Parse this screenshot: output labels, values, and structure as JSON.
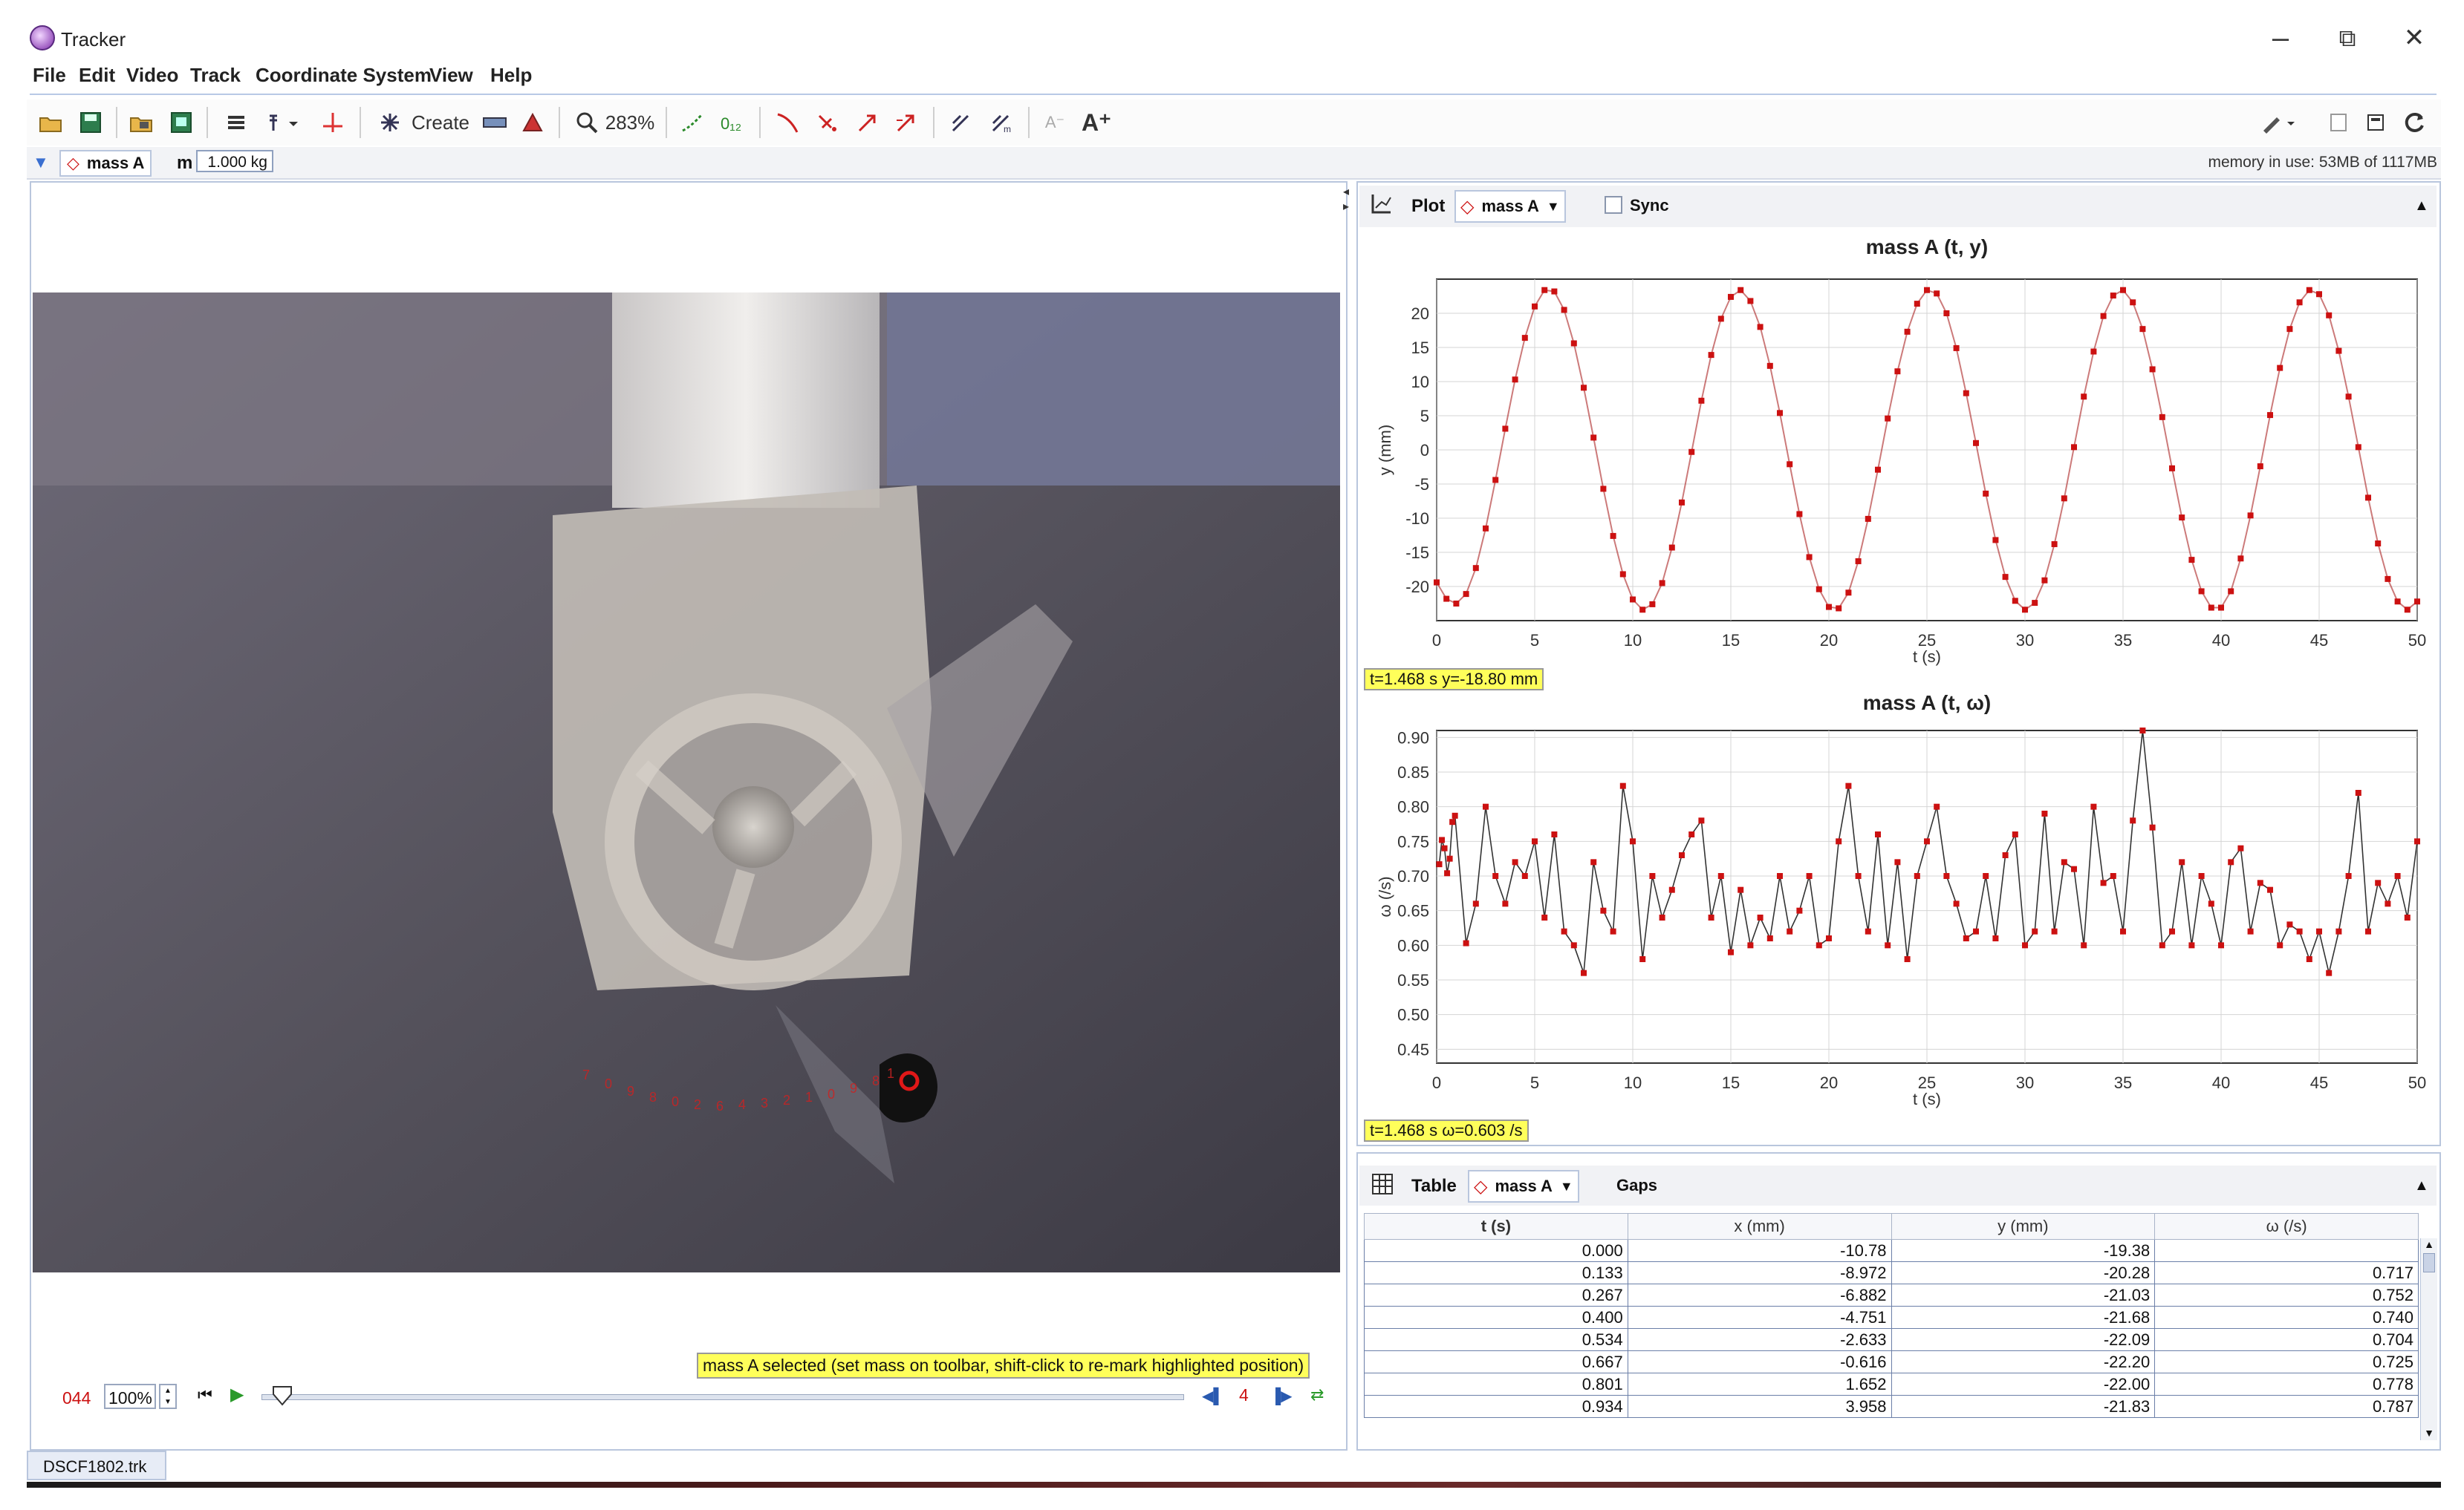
{
  "window": {
    "title": "Tracker",
    "controls": [
      "–",
      "⧉",
      "✕"
    ]
  },
  "menu": [
    "File",
    "Edit",
    "Video",
    "Track",
    "Coordinate System",
    "View",
    "Help"
  ],
  "toolbar": {
    "create_label": "Create",
    "zoom_label": "283%"
  },
  "trackbar": {
    "track_name": "mass A",
    "mass_label": "m",
    "mass_value": "1.000 kg",
    "memory": "memory in use: 53MB of 1117MB"
  },
  "video": {
    "status_message": "mass A selected (set mass on toolbar, shift-click to re-mark highlighted position)",
    "frame_number": "044",
    "rate": "100%",
    "step_size": "4"
  },
  "plot": {
    "header_label": "Plot",
    "track": "mass A",
    "sync_label": "Sync",
    "charts": [
      {
        "title": "mass A (t, y)",
        "xlabel": "t (s)",
        "ylabel": "y (mm)",
        "readout": "t=1.468 s  y=-18.80 mm"
      },
      {
        "title": "mass A (t, ω)",
        "xlabel": "t (s)",
        "ylabel": "ω (/s)",
        "readout": "t=1.468 s  ω=0.603 /s"
      }
    ]
  },
  "chart_data": [
    {
      "type": "scatter",
      "title": "mass A (t, y)",
      "xlabel": "t (s)",
      "ylabel": "y (mm)",
      "xlim": [
        0,
        50
      ],
      "ylim": [
        -25,
        25
      ],
      "xticks": [
        0,
        5,
        10,
        15,
        20,
        25,
        30,
        35,
        40,
        45,
        50
      ],
      "yticks": [
        -20,
        -15,
        -10,
        -5,
        0,
        5,
        10,
        15,
        20
      ],
      "grid": true,
      "series": [
        {
          "x": [
            0.0,
            0.5,
            1.0,
            1.5,
            2.0,
            2.5,
            3.0,
            3.5,
            4.0,
            4.5,
            5.0,
            5.5,
            6.0,
            6.5,
            7.0,
            7.5,
            8.0,
            8.5,
            9.0,
            9.5,
            10.0,
            10.5,
            11.0,
            11.5,
            12.0,
            12.5,
            13.0,
            13.5,
            14.0,
            14.5,
            15.0,
            15.5,
            16.0,
            16.5,
            17.0,
            17.5,
            18.0,
            18.5,
            19.0,
            19.5,
            20.0,
            20.5,
            21.0,
            21.5,
            22.0,
            22.5,
            23.0,
            23.5,
            24.0,
            24.5,
            25.0,
            25.5,
            26.0,
            26.5,
            27.0,
            27.5,
            28.0,
            28.5,
            29.0,
            29.5,
            30.0,
            30.5,
            31.0,
            31.5,
            32.0,
            32.5,
            33.0,
            33.5,
            34.0,
            34.5,
            35.0,
            35.5,
            36.0,
            36.5,
            37.0,
            37.5,
            38.0,
            38.5,
            39.0,
            39.5,
            40.0,
            40.5,
            41.0,
            41.5,
            42.0,
            42.5,
            43.0,
            43.5,
            44.0,
            44.5,
            45.0,
            45.5,
            46.0,
            46.5,
            47.0,
            47.5,
            48.0,
            48.5,
            49.0,
            49.5,
            50.0
          ],
          "y": [
            -19.4,
            -21.8,
            -22.5,
            -21.1,
            -17.3,
            -11.5,
            -4.4,
            3.1,
            10.3,
            16.4,
            21.0,
            23.4,
            23.2,
            20.5,
            15.6,
            9.1,
            1.8,
            -5.7,
            -12.6,
            -18.2,
            -21.9,
            -23.4,
            -22.6,
            -19.5,
            -14.3,
            -7.7,
            -0.3,
            7.2,
            13.9,
            19.2,
            22.4,
            23.4,
            21.8,
            18.0,
            12.3,
            5.4,
            -2.1,
            -9.4,
            -15.7,
            -20.4,
            -23.0,
            -23.2,
            -20.9,
            -16.3,
            -10.1,
            -2.9,
            4.6,
            11.5,
            17.3,
            21.4,
            23.4,
            22.9,
            20.0,
            14.9,
            8.3,
            1.0,
            -6.4,
            -13.2,
            -18.6,
            -22.1,
            -23.4,
            -22.4,
            -19.1,
            -13.8,
            -7.1,
            0.4,
            7.8,
            14.4,
            19.6,
            22.6,
            23.4,
            21.6,
            17.7,
            11.8,
            4.8,
            -2.7,
            -9.9,
            -16.1,
            -20.7,
            -23.1,
            -23.1,
            -20.7,
            -15.9,
            -9.6,
            -2.4,
            5.1,
            12.0,
            17.7,
            21.6,
            23.4,
            22.8,
            19.7,
            14.5,
            7.8,
            0.4,
            -7.0,
            -13.7,
            -18.9,
            -22.2,
            -23.4,
            -22.2
          ]
        }
      ]
    },
    {
      "type": "line",
      "title": "mass A (t, ω)",
      "xlabel": "t (s)",
      "ylabel": "ω (/s)",
      "xlim": [
        0,
        50
      ],
      "ylim": [
        0.43,
        0.91
      ],
      "xticks": [
        0,
        5,
        10,
        15,
        20,
        25,
        30,
        35,
        40,
        45,
        50
      ],
      "yticks": [
        0.45,
        0.5,
        0.55,
        0.6,
        0.65,
        0.7,
        0.75,
        0.8,
        0.85,
        0.9
      ],
      "grid": true,
      "series": [
        {
          "x": [
            0.133,
            0.267,
            0.4,
            0.534,
            0.667,
            0.801,
            0.934,
            1.5,
            2.0,
            2.5,
            3.0,
            3.5,
            4.0,
            4.5,
            5.0,
            5.5,
            6.0,
            6.5,
            7.0,
            7.5,
            8.0,
            8.5,
            9.0,
            9.5,
            10.0,
            10.5,
            11.0,
            11.5,
            12.0,
            12.5,
            13.0,
            13.5,
            14.0,
            14.5,
            15.0,
            15.5,
            16.0,
            16.5,
            17.0,
            17.5,
            18.0,
            18.5,
            19.0,
            19.5,
            20.0,
            20.5,
            21.0,
            21.5,
            22.0,
            22.5,
            23.0,
            23.5,
            24.0,
            24.5,
            25.0,
            25.5,
            26.0,
            26.5,
            27.0,
            27.5,
            28.0,
            28.5,
            29.0,
            29.5,
            30.0,
            30.5,
            31.0,
            31.5,
            32.0,
            32.5,
            33.0,
            33.5,
            34.0,
            34.5,
            35.0,
            35.5,
            36.0,
            36.5,
            37.0,
            37.5,
            38.0,
            38.5,
            39.0,
            39.5,
            40.0,
            40.5,
            41.0,
            41.5,
            42.0,
            42.5,
            43.0,
            43.5,
            44.0,
            44.5,
            45.0,
            45.5,
            46.0,
            46.5,
            47.0,
            47.5,
            48.0,
            48.5,
            49.0,
            49.5,
            50.0
          ],
          "y": [
            0.717,
            0.752,
            0.74,
            0.704,
            0.725,
            0.778,
            0.787,
            0.603,
            0.66,
            0.8,
            0.7,
            0.66,
            0.72,
            0.7,
            0.75,
            0.64,
            0.76,
            0.62,
            0.6,
            0.56,
            0.72,
            0.65,
            0.62,
            0.83,
            0.75,
            0.58,
            0.7,
            0.64,
            0.68,
            0.73,
            0.76,
            0.78,
            0.64,
            0.7,
            0.59,
            0.68,
            0.6,
            0.64,
            0.61,
            0.7,
            0.62,
            0.65,
            0.7,
            0.6,
            0.61,
            0.75,
            0.83,
            0.7,
            0.62,
            0.76,
            0.6,
            0.72,
            0.58,
            0.7,
            0.75,
            0.8,
            0.7,
            0.66,
            0.61,
            0.62,
            0.7,
            0.61,
            0.73,
            0.76,
            0.6,
            0.62,
            0.79,
            0.62,
            0.72,
            0.71,
            0.6,
            0.8,
            0.69,
            0.7,
            0.62,
            0.78,
            0.91,
            0.77,
            0.6,
            0.62,
            0.72,
            0.6,
            0.7,
            0.66,
            0.6,
            0.72,
            0.74,
            0.62,
            0.69,
            0.68,
            0.6,
            0.63,
            0.62,
            0.58,
            0.62,
            0.56,
            0.62,
            0.7,
            0.82,
            0.62,
            0.69,
            0.66,
            0.7,
            0.64,
            0.75
          ]
        }
      ]
    },
    {
      "type": "table",
      "columns": [
        "t (s)",
        "x (mm)",
        "y (mm)",
        "ω (/s)"
      ],
      "rows": [
        [
          "0.000",
          "-10.78",
          "-19.38",
          ""
        ],
        [
          "0.133",
          "-8.972",
          "-20.28",
          "0.717"
        ],
        [
          "0.267",
          "-6.882",
          "-21.03",
          "0.752"
        ],
        [
          "0.400",
          "-4.751",
          "-21.68",
          "0.740"
        ],
        [
          "0.534",
          "-2.633",
          "-22.09",
          "0.704"
        ],
        [
          "0.667",
          "-0.616",
          "-22.20",
          "0.725"
        ],
        [
          "0.801",
          "1.652",
          "-22.00",
          "0.778"
        ],
        [
          "0.934",
          "3.958",
          "-21.83",
          "0.787"
        ]
      ]
    }
  ],
  "table_panel": {
    "header_label": "Table",
    "track": "mass A",
    "gaps_label": "Gaps"
  },
  "file_tab": "DSCF1802.trk",
  "colors": {
    "accent_red": "#cc1111",
    "panel_border": "#b9c6dd",
    "readout_yellow": "#ffff5a"
  }
}
